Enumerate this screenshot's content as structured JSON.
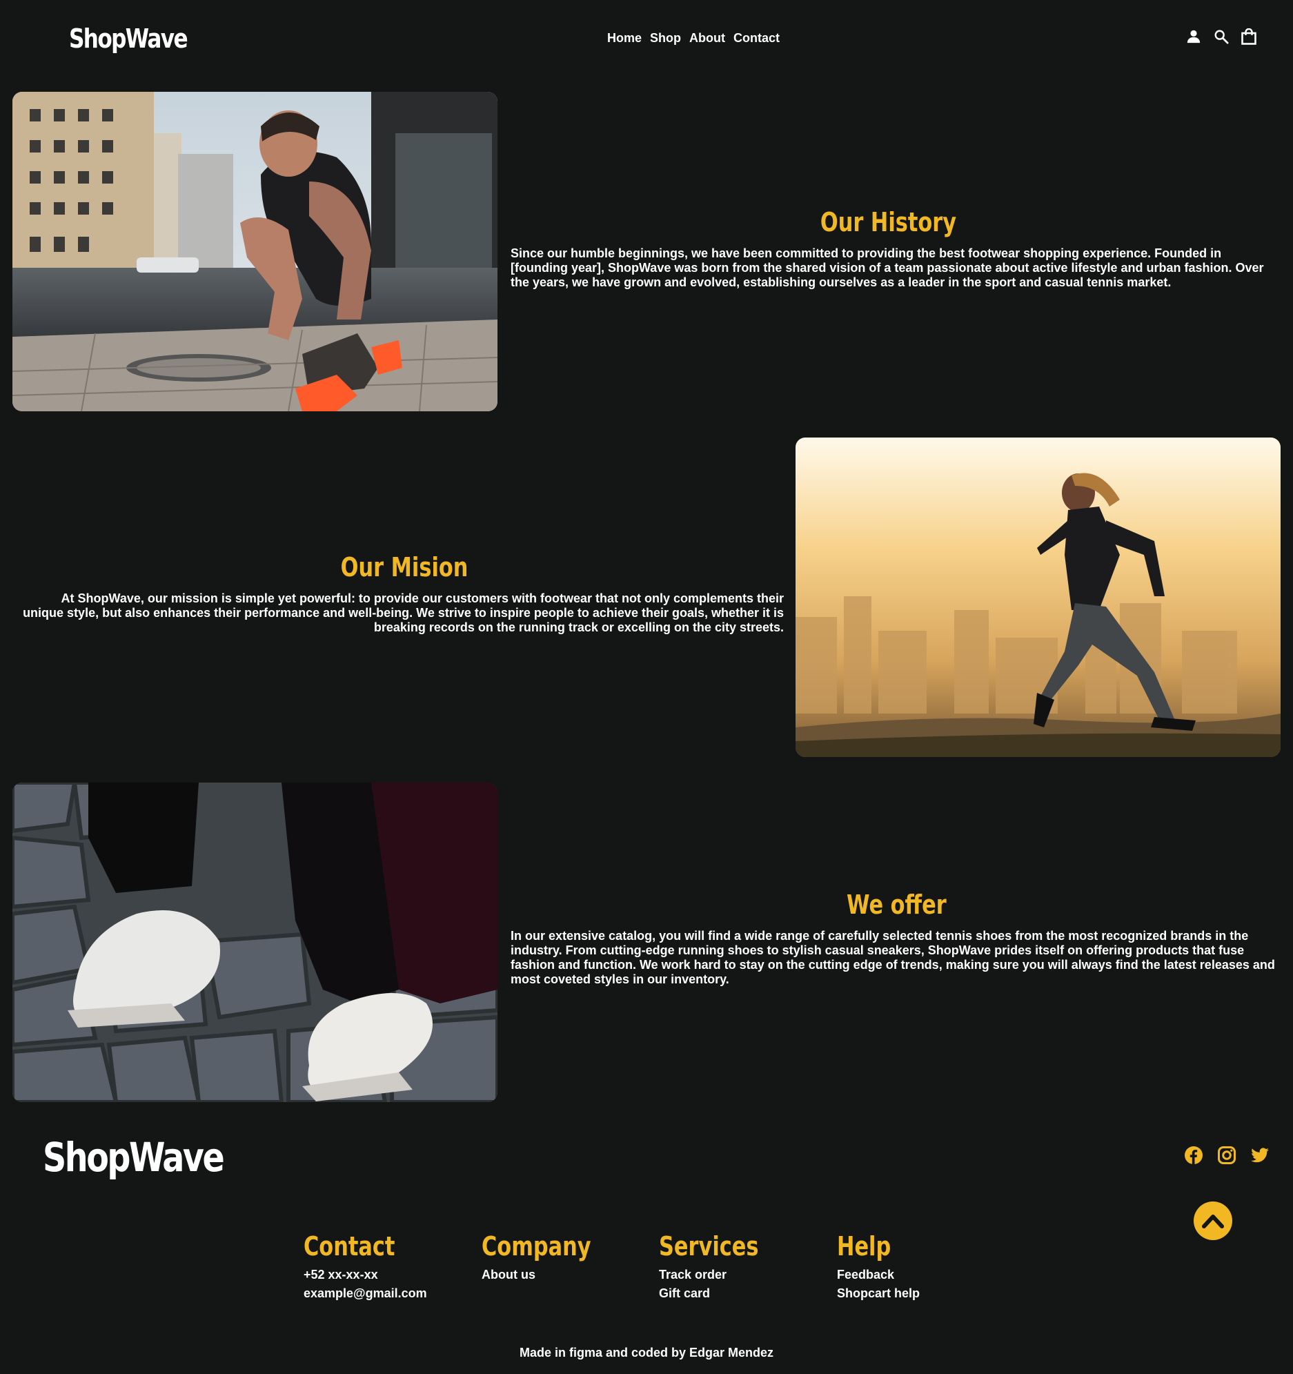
{
  "header": {
    "logo": "ShopWave",
    "nav": [
      "Home",
      "Shop",
      "About",
      "Contact"
    ],
    "icons": [
      "user-icon",
      "search-icon",
      "shopping-bag-icon"
    ]
  },
  "sections": [
    {
      "title": "Our History",
      "text": "Since our humble beginnings, we have been committed to providing the best footwear shopping experience. Founded in [founding year], ShopWave was born from the shared vision of a team passionate about active lifestyle and urban fashion. Over the years, we have grown and evolved, establishing ourselves as a leader in the sport and casual tennis market."
    },
    {
      "title": "Our Mision",
      "text": "At ShopWave, our mission is simple yet powerful: to provide our customers with footwear that not only complements their unique style, but also enhances their performance and well-being. We strive to inspire people to achieve their goals, whether it is breaking records on the running track or excelling on the city streets."
    },
    {
      "title": "We offer",
      "text": "In our extensive catalog, you will find a wide range of carefully selected tennis shoes from the most recognized brands in the industry. From cutting-edge running shoes to stylish casual sneakers, ShopWave prides itself on offering products that fuse fashion and function. We work hard to stay on the cutting edge of trends, making sure you will always find the latest releases and most coveted styles in our inventory."
    }
  ],
  "footer": {
    "logo": "ShopWave",
    "social": [
      "facebook-icon",
      "instagram-icon",
      "twitter-icon"
    ],
    "columns": [
      {
        "title": "Contact",
        "items": [
          "+52 xx-xx-xx",
          "example@gmail.com"
        ]
      },
      {
        "title": "Company",
        "items": [
          "About us"
        ]
      },
      {
        "title": "Services",
        "items": [
          "Track order",
          "Gift card"
        ]
      },
      {
        "title": "Help",
        "items": [
          "Feedback",
          "Shopcart help"
        ]
      }
    ],
    "credit": "Made in figma and coded by Edgar Mendez"
  },
  "colors": {
    "background": "#141616",
    "accent": "#f2b823",
    "text": "#ffffff"
  }
}
